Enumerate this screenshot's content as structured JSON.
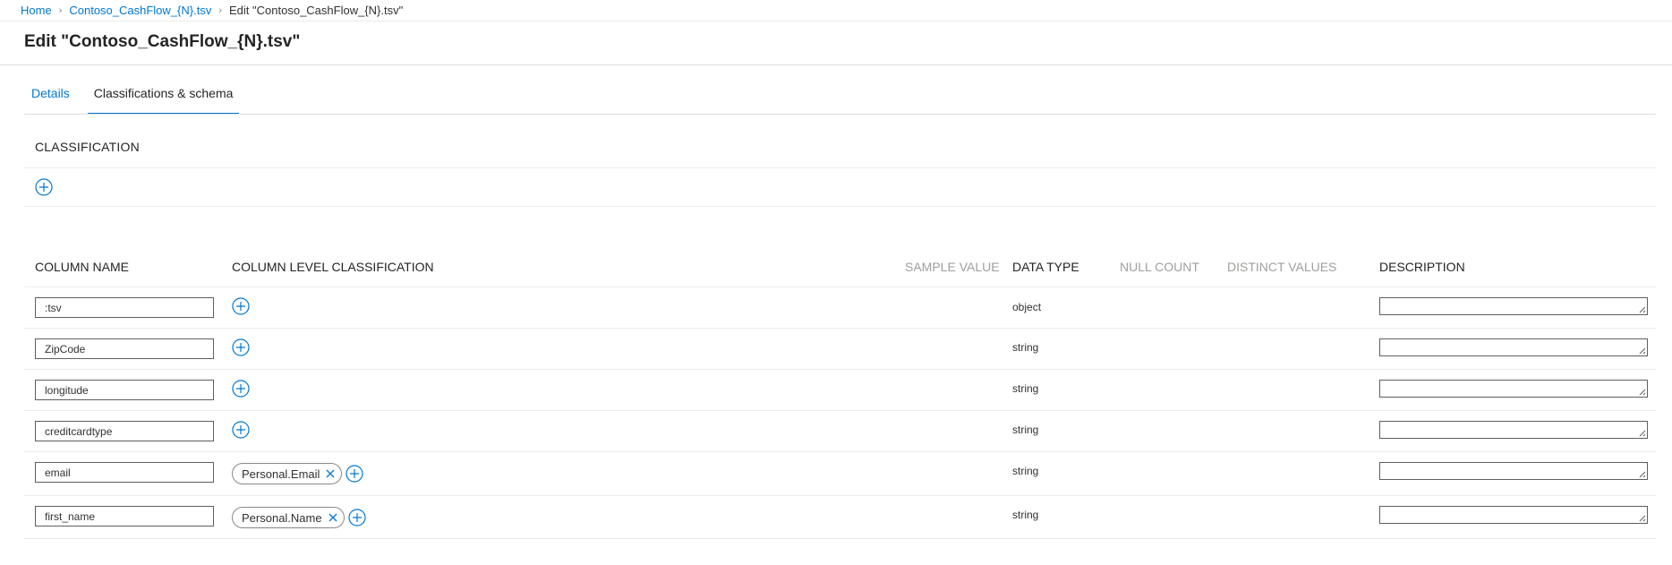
{
  "breadcrumb": {
    "home": "Home",
    "asset": "Contoso_CashFlow_{N}.tsv",
    "current": "Edit \"Contoso_CashFlow_{N}.tsv\""
  },
  "page": {
    "title": "Edit \"Contoso_CashFlow_{N}.tsv\""
  },
  "tabs": [
    {
      "label": "Details",
      "active": false
    },
    {
      "label": "Classifications & schema",
      "active": true
    }
  ],
  "classification": {
    "label": "CLASSIFICATION"
  },
  "schema": {
    "headers": {
      "column_name": "COLUMN NAME",
      "column_level_classification": "COLUMN LEVEL CLASSIFICATION",
      "sample_value": "SAMPLE VALUE",
      "data_type": "DATA TYPE",
      "null_count": "NULL COUNT",
      "distinct_values": "DISTINCT VALUES",
      "description": "DESCRIPTION"
    },
    "rows": [
      {
        "name": ":tsv",
        "type": "object",
        "tags": []
      },
      {
        "name": "ZipCode",
        "type": "string",
        "tags": []
      },
      {
        "name": "longitude",
        "type": "string",
        "tags": []
      },
      {
        "name": "creditcardtype",
        "type": "string",
        "tags": []
      },
      {
        "name": "email",
        "type": "string",
        "tags": [
          "Personal.Email"
        ]
      },
      {
        "name": "first_name",
        "type": "string",
        "tags": [
          "Personal.Name"
        ]
      }
    ]
  },
  "colors": {
    "accent": "#0078d4",
    "text": "#323130",
    "muted": "#a19f9d",
    "border": "#e1dfdd"
  },
  "icons": {
    "add": "add-circle-icon",
    "remove": "close-icon",
    "breadcrumb_sep": "chevron-right-icon"
  }
}
